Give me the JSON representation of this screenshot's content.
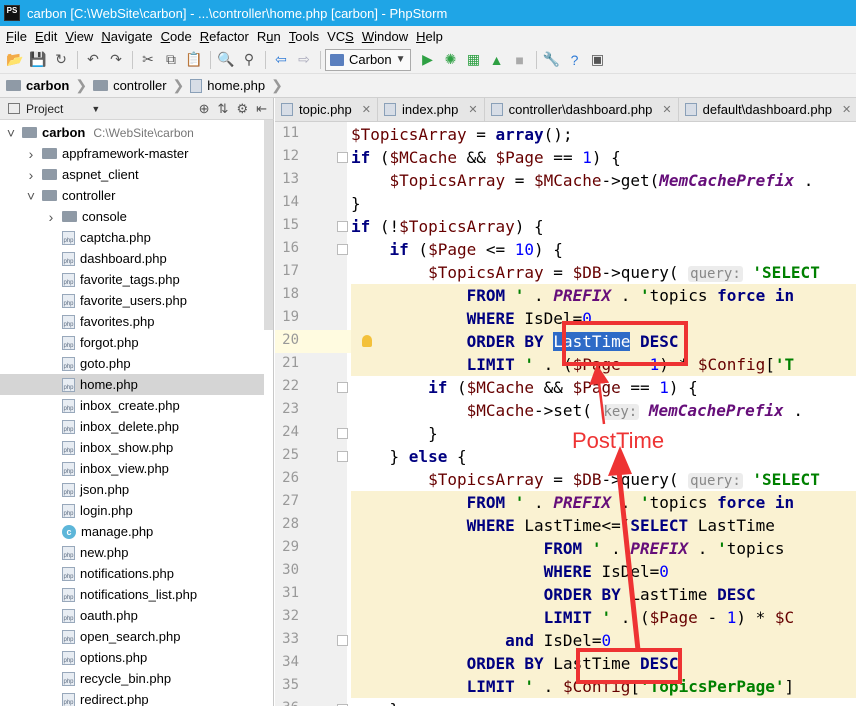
{
  "window": {
    "app_icon_text": "PS",
    "title": "carbon [C:\\WebSite\\carbon] - ...\\controller\\home.php [carbon] - PhpStorm"
  },
  "menu": [
    {
      "pre": "",
      "ul": "F",
      "post": "ile"
    },
    {
      "pre": "",
      "ul": "E",
      "post": "dit"
    },
    {
      "pre": "",
      "ul": "V",
      "post": "iew"
    },
    {
      "pre": "",
      "ul": "N",
      "post": "avigate"
    },
    {
      "pre": "",
      "ul": "C",
      "post": "ode"
    },
    {
      "pre": "",
      "ul": "R",
      "post": "efactor"
    },
    {
      "pre": "R",
      "ul": "u",
      "post": "n"
    },
    {
      "pre": "",
      "ul": "T",
      "post": "ools"
    },
    {
      "pre": "VC",
      "ul": "S",
      "post": ""
    },
    {
      "pre": "",
      "ul": "W",
      "post": "indow"
    },
    {
      "pre": "",
      "ul": "H",
      "post": "elp"
    }
  ],
  "toolbar": {
    "run_config": "Carbon",
    "icons": [
      "folder-open-icon",
      "save-icon",
      "sync-icon",
      "undo-icon",
      "redo-icon",
      "cut-icon",
      "copy-icon",
      "paste-icon",
      "find-icon",
      "replace-icon",
      "back-icon",
      "forward-icon",
      "run-config-icon",
      "run-icon",
      "debug-icon",
      "coverage-icon",
      "stop-icon",
      "settings-icon",
      "help-icon",
      "external-icon"
    ]
  },
  "breadcrumb": [
    {
      "label": "carbon",
      "type": "folder"
    },
    {
      "label": "controller",
      "type": "folder"
    },
    {
      "label": "home.php",
      "type": "php"
    }
  ],
  "project_panel": {
    "title": "Project",
    "tree": [
      {
        "label": "carbon",
        "path": "C:\\WebSite\\carbon",
        "type": "folder",
        "depth": 0,
        "arrow": "open"
      },
      {
        "label": "appframework-master",
        "type": "folder",
        "depth": 1,
        "arrow": "closed"
      },
      {
        "label": "aspnet_client",
        "type": "folder",
        "depth": 1,
        "arrow": "closed"
      },
      {
        "label": "controller",
        "type": "folder",
        "depth": 1,
        "arrow": "open"
      },
      {
        "label": "console",
        "type": "folder",
        "depth": 2,
        "arrow": "closed"
      },
      {
        "label": "captcha.php",
        "type": "php",
        "depth": 2
      },
      {
        "label": "dashboard.php",
        "type": "php",
        "depth": 2
      },
      {
        "label": "favorite_tags.php",
        "type": "php",
        "depth": 2
      },
      {
        "label": "favorite_users.php",
        "type": "php",
        "depth": 2
      },
      {
        "label": "favorites.php",
        "type": "php",
        "depth": 2
      },
      {
        "label": "forgot.php",
        "type": "php",
        "depth": 2
      },
      {
        "label": "goto.php",
        "type": "php",
        "depth": 2
      },
      {
        "label": "home.php",
        "type": "php",
        "depth": 2,
        "selected": true
      },
      {
        "label": "inbox_create.php",
        "type": "php",
        "depth": 2
      },
      {
        "label": "inbox_delete.php",
        "type": "php",
        "depth": 2
      },
      {
        "label": "inbox_show.php",
        "type": "php",
        "depth": 2
      },
      {
        "label": "inbox_view.php",
        "type": "php",
        "depth": 2
      },
      {
        "label": "json.php",
        "type": "php",
        "depth": 2
      },
      {
        "label": "login.php",
        "type": "php",
        "depth": 2
      },
      {
        "label": "manage.php",
        "type": "class",
        "depth": 2
      },
      {
        "label": "new.php",
        "type": "php",
        "depth": 2
      },
      {
        "label": "notifications.php",
        "type": "php",
        "depth": 2
      },
      {
        "label": "notifications_list.php",
        "type": "php",
        "depth": 2
      },
      {
        "label": "oauth.php",
        "type": "php",
        "depth": 2
      },
      {
        "label": "open_search.php",
        "type": "php",
        "depth": 2
      },
      {
        "label": "options.php",
        "type": "php",
        "depth": 2
      },
      {
        "label": "recycle_bin.php",
        "type": "php",
        "depth": 2
      },
      {
        "label": "redirect.php",
        "type": "php",
        "depth": 2
      }
    ]
  },
  "tabs": [
    {
      "label": "topic.php"
    },
    {
      "label": "index.php"
    },
    {
      "label": "controller\\dashboard.php"
    },
    {
      "label": "default\\dashboard.php"
    }
  ],
  "editor": {
    "lines": [
      {
        "n": 11,
        "html": "<span class='var'>$TopicsArray</span> = <span class='kw'>array</span>();"
      },
      {
        "n": 12,
        "html": "<span class='kw'>if</span> (<span class='var'>$MCache</span> &amp;&amp; <span class='var'>$Page</span> == <span class='num'>1</span>) {"
      },
      {
        "n": 13,
        "html": "    <span class='var'>$TopicsArray</span> = <span class='var'>$MCache</span>-&gt;get(<span class='const'>MemCachePrefix</span> . "
      },
      {
        "n": 14,
        "html": "}"
      },
      {
        "n": 15,
        "html": "<span class='kw'>if</span> (!<span class='var'>$TopicsArray</span>) {"
      },
      {
        "n": 16,
        "html": "    <span class='kw'>if</span> (<span class='var'>$Page</span> &lt;= <span class='num'>10</span>) {"
      },
      {
        "n": 17,
        "html": "        <span class='var'>$TopicsArray</span> = <span class='var'>$DB</span>-&gt;query( <span class='hint'>query:</span> <span class='str'>'SELECT</span>"
      },
      {
        "n": 18,
        "html": "            <span class='sqlkw'>FROM</span> <span class='str'>'</span> . <span class='const'>PREFIX</span> . <span class='str'>'</span>topics <span class='sqlkw'>force</span> <span class='sqlkw'>in</span>",
        "hl": true
      },
      {
        "n": 19,
        "html": "            <span class='sqlkw'>WHERE</span> IsDel=<span class='num'>0</span>",
        "hl": true
      },
      {
        "n": 20,
        "html": "            <span class='sqlkw'>ORDER</span> <span class='sqlkw'>BY</span> <span class='sel'>LastTime</span> <span class='sqlkw'>DESC</span>",
        "hl": true,
        "current": true
      },
      {
        "n": 21,
        "html": "            <span class='sqlkw'>LIMIT</span> <span class='str'>'</span> . (<span class='var'>$Page</span> - <span class='num'>1</span>) * <span class='var'>$Config</span>[<span class='str'>'T</span>",
        "hl": true
      },
      {
        "n": 22,
        "html": "        <span class='kw'>if</span> (<span class='var'>$MCache</span> &amp;&amp; <span class='var'>$Page</span> == <span class='num'>1</span>) {"
      },
      {
        "n": 23,
        "html": "            <span class='var'>$MCache</span>-&gt;set( <span class='hint'>key:</span> <span class='const'>MemCachePrefix</span> . "
      },
      {
        "n": 24,
        "html": "        }"
      },
      {
        "n": 25,
        "html": "    } <span class='kw'>else</span> {"
      },
      {
        "n": 26,
        "html": "        <span class='var'>$TopicsArray</span> = <span class='var'>$DB</span>-&gt;query( <span class='hint'>query:</span> <span class='str'>'SELECT</span>"
      },
      {
        "n": 27,
        "html": "            <span class='sqlkw'>FROM</span> <span class='str'>'</span> . <span class='const'>PREFIX</span> . <span class='str'>'</span>topics <span class='sqlkw'>force</span> <span class='sqlkw'>in</span>",
        "hl": true
      },
      {
        "n": 28,
        "html": "            <span class='sqlkw'>WHERE</span> LastTime&lt;=(<span class='sqlkw'>SELECT</span> LastTime",
        "hl": true
      },
      {
        "n": 29,
        "html": "                    <span class='sqlkw'>FROM</span> <span class='str'>'</span> . <span class='const'>PREFIX</span> . <span class='str'>'</span>topics",
        "hl": true
      },
      {
        "n": 30,
        "html": "                    <span class='sqlkw'>WHERE</span> IsDel=<span class='num'>0</span>",
        "hl": true
      },
      {
        "n": 31,
        "html": "                    <span class='sqlkw'>ORDER</span> <span class='sqlkw'>BY</span> LastTime <span class='sqlkw'>DESC</span>",
        "hl": true
      },
      {
        "n": 32,
        "html": "                    <span class='sqlkw'>LIMIT</span> <span class='str'>'</span> . (<span class='var'>$Page</span> - <span class='num'>1</span>) * <span class='var'>$C</span>",
        "hl": true
      },
      {
        "n": 33,
        "html": "                <span class='sqlkw'>and</span> IsDel=<span class='num'>0</span>",
        "hl": true
      },
      {
        "n": 34,
        "html": "            <span class='sqlkw'>ORDER</span> <span class='sqlkw'>BY</span> LastTime <span class='sqlkw'>DESC</span>",
        "hl": true
      },
      {
        "n": 35,
        "html": "            <span class='sqlkw'>LIMIT</span> <span class='str'>'</span> . <span class='var'>$Config</span>[<span class='str'>'TopicsPerPage'</span>]",
        "hl": true
      },
      {
        "n": 36,
        "html": "    }"
      }
    ]
  },
  "annotation": {
    "label": "PostTime",
    "color": "#ee3333"
  }
}
